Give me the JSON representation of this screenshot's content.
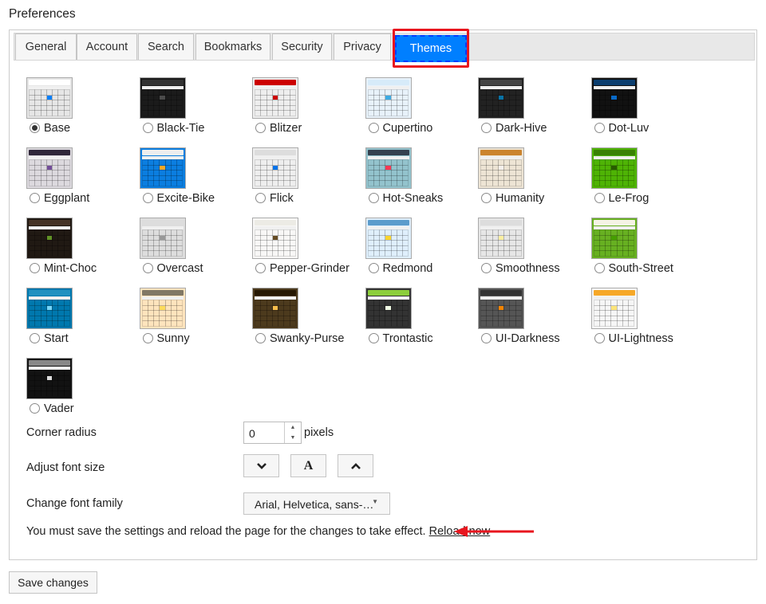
{
  "page_title": "Preferences",
  "tabs": [
    {
      "label": "General"
    },
    {
      "label": "Account"
    },
    {
      "label": "Search"
    },
    {
      "label": "Bookmarks"
    },
    {
      "label": "Security"
    },
    {
      "label": "Privacy"
    },
    {
      "label": "Themes",
      "active": true
    }
  ],
  "themes": [
    {
      "name": "Base",
      "selected": true,
      "header": "#ffffff",
      "cell": "#e6e6e6",
      "accent": "#007fff"
    },
    {
      "name": "Black-Tie",
      "header": "#333333",
      "cell": "#1b1b1b",
      "accent": "#4b4b4b"
    },
    {
      "name": "Blitzer",
      "header": "#cc0000",
      "cell": "#eeeeee",
      "accent": "#cc0000"
    },
    {
      "name": "Cupertino",
      "header": "#d7ebf9",
      "cell": "#e8f2fa",
      "accent": "#3baae3"
    },
    {
      "name": "Dark-Hive",
      "header": "#444444",
      "cell": "#222222",
      "accent": "#0972a5"
    },
    {
      "name": "Dot-Luv",
      "header": "#0b3e6f",
      "cell": "#111111",
      "accent": "#096ac8"
    },
    {
      "name": "Eggplant",
      "header": "#30273a",
      "cell": "#dcd9de",
      "accent": "#734d99"
    },
    {
      "name": "Excite-Bike",
      "header": "#eeeeee",
      "cell": "#0b7ee0",
      "accent": "#f6a828"
    },
    {
      "name": "Flick",
      "header": "#dddddd",
      "cell": "#eeeeee",
      "accent": "#0073ea"
    },
    {
      "name": "Hot-Sneaks",
      "header": "#35414f",
      "cell": "#93c3cd",
      "accent": "#ff3853"
    },
    {
      "name": "Humanity",
      "header": "#cb842e",
      "cell": "#ede4d4",
      "accent": "#f4f0ec"
    },
    {
      "name": "Le-Frog",
      "header": "#3a8104",
      "cell": "#4eb305",
      "accent": "#285c00"
    },
    {
      "name": "Mint-Choc",
      "header": "#453326",
      "cell": "#201913",
      "accent": "#619226"
    },
    {
      "name": "Overcast",
      "header": "#dddddd",
      "cell": "#dddddd",
      "accent": "#999999"
    },
    {
      "name": "Pepper-Grinder",
      "header": "#ecebe5",
      "cell": "#f8f7f6",
      "accent": "#654b24"
    },
    {
      "name": "Redmond",
      "header": "#5c9ccc",
      "cell": "#dfeffc",
      "accent": "#fad42e"
    },
    {
      "name": "Smoothness",
      "header": "#dddddd",
      "cell": "#e6e6e6",
      "accent": "#fcefa1"
    },
    {
      "name": "South-Street",
      "header": "#f5f3e5",
      "cell": "#67b021",
      "accent": "#459e00"
    },
    {
      "name": "Start",
      "header": "#2191c0",
      "cell": "#0078ae",
      "accent": "#77d5f7"
    },
    {
      "name": "Sunny",
      "header": "#817865",
      "cell": "#fee4bd",
      "accent": "#fddb5c"
    },
    {
      "name": "Swanky-Purse",
      "header": "#261803",
      "cell": "#4c3a1d",
      "accent": "#f8be4c"
    },
    {
      "name": "Trontastic",
      "header": "#8cce3b",
      "cell": "#333333",
      "accent": "#f1fbe5"
    },
    {
      "name": "UI-Darkness",
      "header": "#333333",
      "cell": "#555555",
      "accent": "#f58400"
    },
    {
      "name": "UI-Lightness",
      "header": "#f6a828",
      "cell": "#f6f6f6",
      "accent": "#fde478"
    },
    {
      "name": "Vader",
      "header": "#888888",
      "cell": "#121212",
      "accent": "#dddddd"
    }
  ],
  "settings": {
    "corner_radius_label": "Corner radius",
    "corner_radius_value": "0",
    "corner_radius_unit": "pixels",
    "font_size_label": "Adjust font size",
    "font_size_icon": "A",
    "font_family_label": "Change font family",
    "font_family_value": "Arial, Helvetica, sans-…",
    "note_text": "You must save the settings and reload the page for the changes to take effect.",
    "reload_link": "Reload now"
  },
  "save_button": "Save changes",
  "colors": {
    "highlight": "#e8161f",
    "active_tab": "#007fff"
  }
}
